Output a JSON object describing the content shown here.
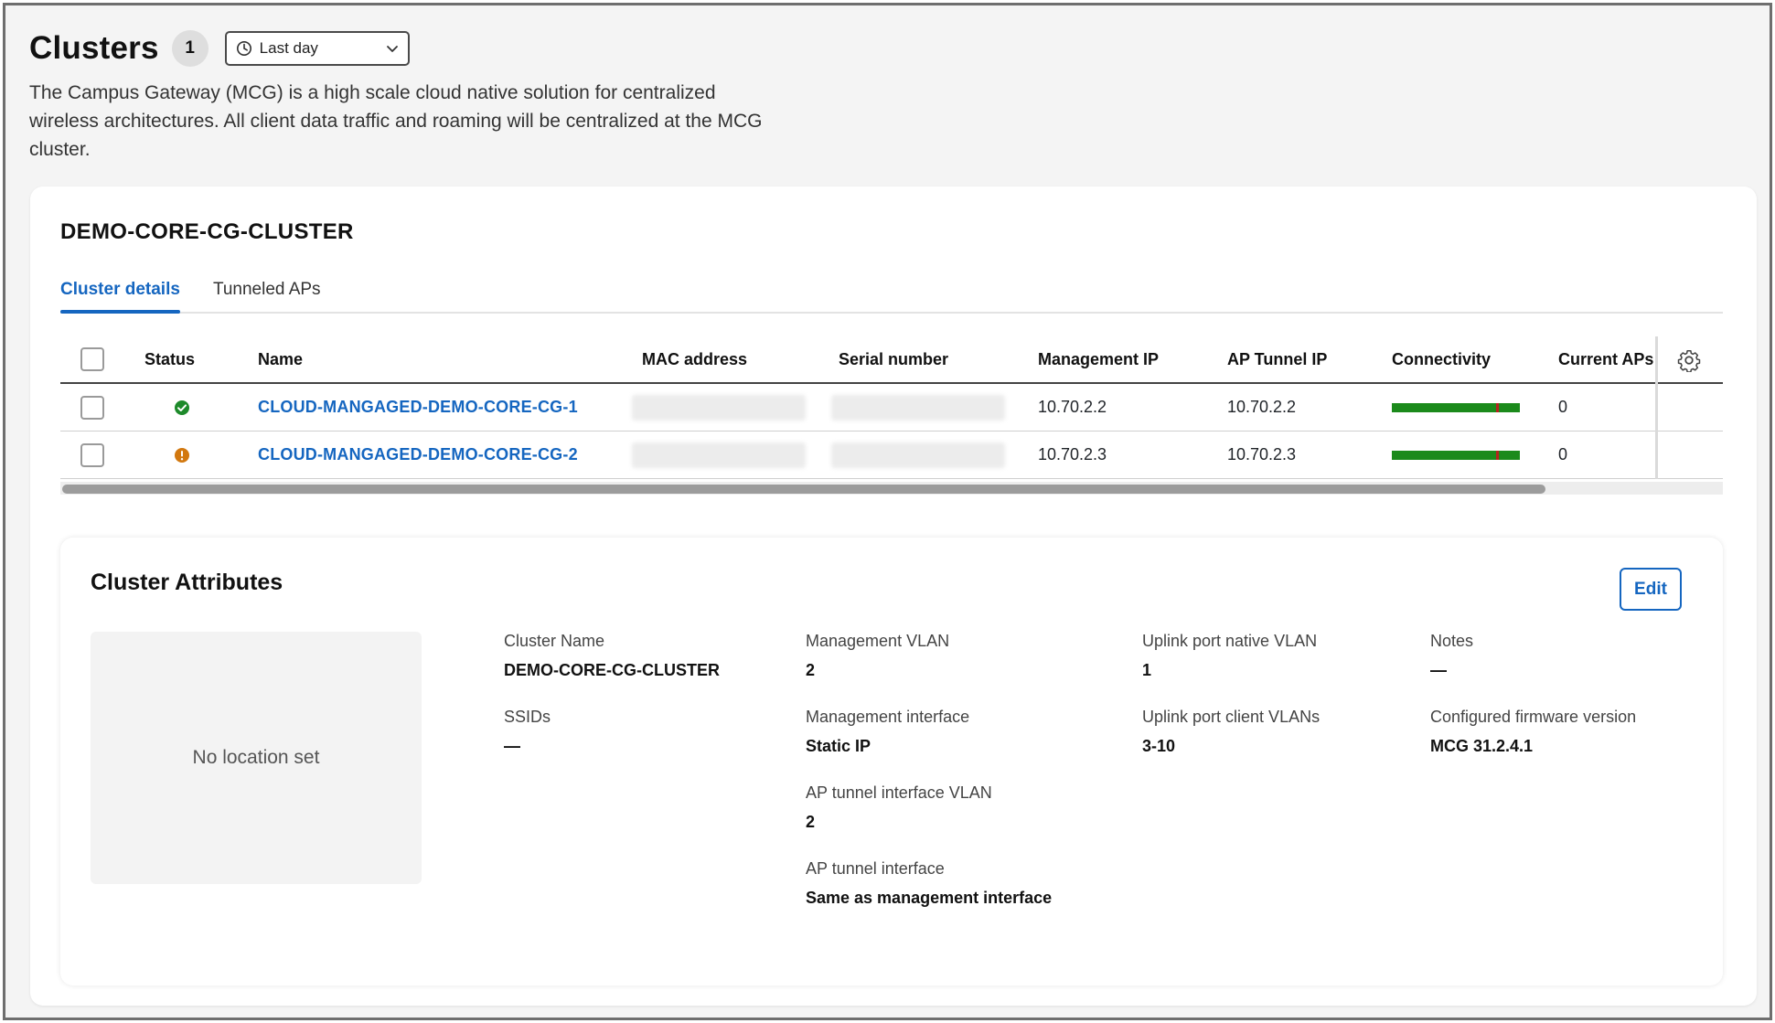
{
  "header": {
    "title": "Clusters",
    "count": "1",
    "time_range": "Last day",
    "description": "The Campus Gateway (MCG) is a high scale cloud native solution for centralized wireless architectures. All client data traffic and roaming will be centralized at the MCG cluster."
  },
  "cluster": {
    "name": "DEMO-CORE-CG-CLUSTER",
    "tabs": [
      {
        "label": "Cluster details",
        "active": true
      },
      {
        "label": "Tunneled APs",
        "active": false
      }
    ]
  },
  "table": {
    "columns": [
      "Status",
      "Name",
      "MAC address",
      "Serial number",
      "Management IP",
      "AP Tunnel IP",
      "Connectivity",
      "Current APs"
    ],
    "rows": [
      {
        "status": "healthy",
        "status_color": "#1d8a2a",
        "name": "CLOUD-MANGAGED-DEMO-CORE-CG-1",
        "management_ip": "10.70.2.2",
        "ap_tunnel_ip": "10.70.2.2",
        "current_aps": "0"
      },
      {
        "status": "warning",
        "status_color": "#d2780f",
        "name": "CLOUD-MANGAGED-DEMO-CORE-CG-2",
        "management_ip": "10.70.2.3",
        "ap_tunnel_ip": "10.70.2.3",
        "current_aps": "0"
      }
    ]
  },
  "attributes": {
    "title": "Cluster Attributes",
    "edit_label": "Edit",
    "location_placeholder": "No location set",
    "cluster_name_label": "Cluster Name",
    "cluster_name_value": "DEMO-CORE-CG-CLUSTER",
    "ssids_label": "SSIDs",
    "ssids_value": "—",
    "mgmt_vlan_label": "Management VLAN",
    "mgmt_vlan_value": "2",
    "mgmt_interface_label": "Management interface",
    "mgmt_interface_value": "Static IP",
    "ap_tunnel_vlan_label": "AP tunnel interface VLAN",
    "ap_tunnel_vlan_value": "2",
    "ap_tunnel_iface_label": "AP tunnel interface",
    "ap_tunnel_iface_value": "Same as management interface",
    "uplink_native_label": "Uplink port native VLAN",
    "uplink_native_value": "1",
    "uplink_client_label": "Uplink port client VLANs",
    "uplink_client_value": "3-10",
    "notes_label": "Notes",
    "notes_value": "—",
    "firmware_label": "Configured firmware version",
    "firmware_value": "MCG 31.2.4.1"
  },
  "colors": {
    "accent": "#1566c0",
    "connectivity_good": "#1b8a1b",
    "connectivity_mark": "#b4241e"
  }
}
